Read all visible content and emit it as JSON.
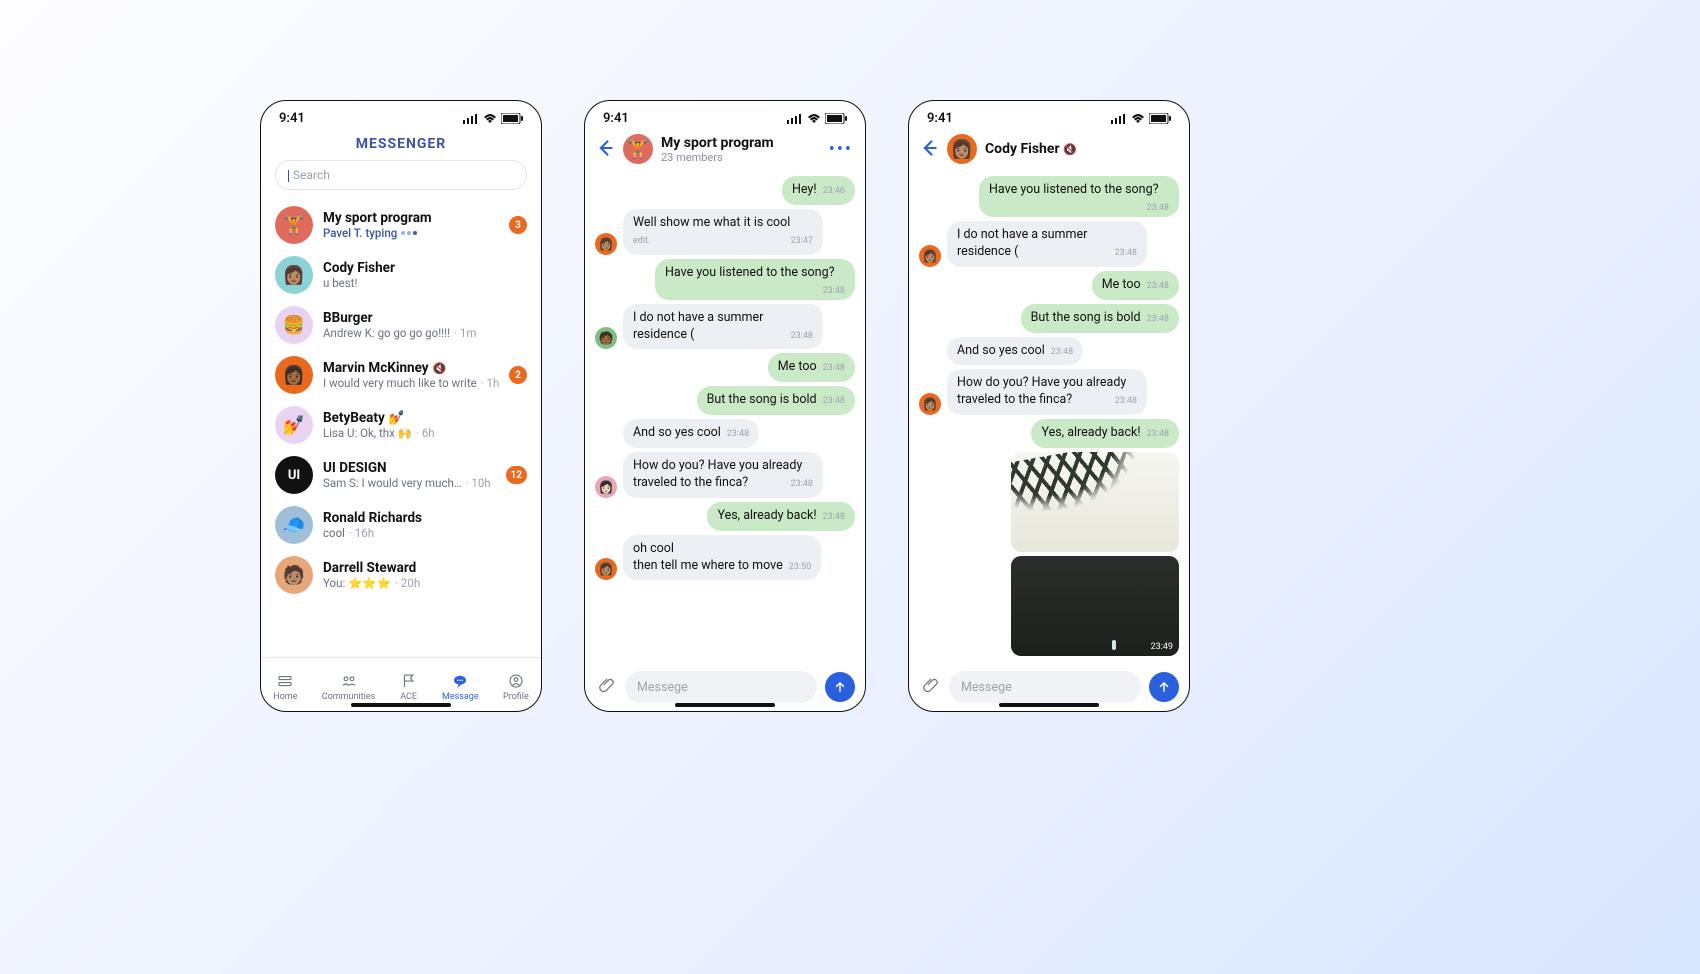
{
  "status": {
    "time": "9:41"
  },
  "screen1": {
    "brand": "MESSENGER",
    "search_placeholder": "Search",
    "chats": [
      {
        "name": "My sport program",
        "sub_prefix": "Pavel T. typing",
        "time": "",
        "badge": "3",
        "avatar_bg": "#e06a5c",
        "emoji": "🏋️"
      },
      {
        "name": "Cody Fisher",
        "sub": "u best!",
        "time": "",
        "badge": "",
        "avatar_bg": "#8cd3d8",
        "emoji": "👩🏽"
      },
      {
        "name": "BBurger",
        "sub": "Andrew K: go go go go!!!!",
        "time": "1m",
        "badge": "",
        "avatar_bg": "#e7d2f2",
        "emoji": "🍔"
      },
      {
        "name": "Marvin McKinney",
        "muted": true,
        "sub": "I would very much like to write",
        "time": "1h",
        "badge": "2",
        "avatar_bg": "#e96a1f",
        "emoji": "👩🏾"
      },
      {
        "name": "BetyBeaty 💅",
        "sub": "Lisa U: Ok, thx 🙌",
        "time": "6h",
        "badge": "",
        "avatar_bg": "#ead3f1",
        "emoji": "💅"
      },
      {
        "name": "UI DESIGN",
        "sub": "Sam S: I would very much…",
        "time": "10h",
        "badge": "12",
        "avatar_bg": "#111111",
        "emoji": "",
        "letters": "UI"
      },
      {
        "name": "Ronald Richards",
        "sub": "cool",
        "time": "16h",
        "badge": "",
        "avatar_bg": "#9fbfd8",
        "emoji": "🧢"
      },
      {
        "name": "Darrell Steward",
        "sub": "You: ⭐⭐⭐",
        "time": "20h",
        "badge": "",
        "avatar_bg": "#e7a77a",
        "emoji": "🧑🏽"
      }
    ],
    "tabs": {
      "home": "Home",
      "communities": "Communities",
      "ace": "ACE",
      "message": "Message",
      "profile": "Profile"
    }
  },
  "screen2": {
    "title": "My sport program",
    "subtitle": "23 members",
    "avatar_bg": "#e06a5c",
    "avatar_emoji": "🏋️",
    "messages": [
      {
        "side": "me",
        "text": "Hey!",
        "ts": "23:46"
      },
      {
        "side": "other",
        "text": "Well show me what it is cool",
        "edit": "edit.",
        "ts": "23:47",
        "avatar": "👩🏽",
        "avbg": "#e96a1f"
      },
      {
        "side": "me",
        "text": "Have you listened to the song?",
        "ts": "23:48"
      },
      {
        "side": "other",
        "text": "I do not have a summer residence (",
        "ts": "23:48",
        "avatar": "🧑🏾",
        "avbg": "#7fbf7f"
      },
      {
        "side": "me",
        "text": "Me too",
        "ts": "23:48"
      },
      {
        "side": "me",
        "text": "But the song is bold",
        "ts": "23:48"
      },
      {
        "side": "other",
        "text": "And so yes cool",
        "ts": "23:48",
        "noav": true
      },
      {
        "side": "other",
        "text": "How do you? Have you already traveled to the finca?",
        "ts": "23:48",
        "avatar": "👩🏻",
        "avbg": "#e7a7b5"
      },
      {
        "side": "me",
        "text": "Yes, already back!",
        "ts": "23:48"
      },
      {
        "side": "other",
        "text": "oh cool\nthen tell me where to move",
        "ts": "23:50",
        "avatar": "👩🏽",
        "avbg": "#e96a1f"
      }
    ],
    "composer_placeholder": "Messege"
  },
  "screen3": {
    "title": "Cody Fisher",
    "muted": true,
    "avatar_bg": "#e96a1f",
    "avatar_emoji": "👩🏽",
    "messages": [
      {
        "side": "me",
        "text": "Have you listened to the song?",
        "ts": "23:48"
      },
      {
        "side": "other",
        "text": "I do not have a summer residence (",
        "ts": "23:48",
        "avatar": "👩🏽",
        "avbg": "#e96a1f"
      },
      {
        "side": "me",
        "text": "Me too",
        "ts": "23:48"
      },
      {
        "side": "me",
        "text": "But the song is bold",
        "ts": "23:48"
      },
      {
        "side": "other",
        "text": "And so yes cool",
        "ts": "23:48",
        "noav": true
      },
      {
        "side": "other",
        "text": "How do you? Have you already traveled to the finca?",
        "ts": "23:48",
        "avatar": "👩🏽",
        "avbg": "#e96a1f"
      },
      {
        "side": "me",
        "text": "Yes, already back!",
        "ts": "23:48"
      },
      {
        "side": "me",
        "image": "palm",
        "ts": ""
      },
      {
        "side": "me",
        "image": "rock",
        "ts": "23:49"
      }
    ],
    "composer_placeholder": "Messege"
  }
}
